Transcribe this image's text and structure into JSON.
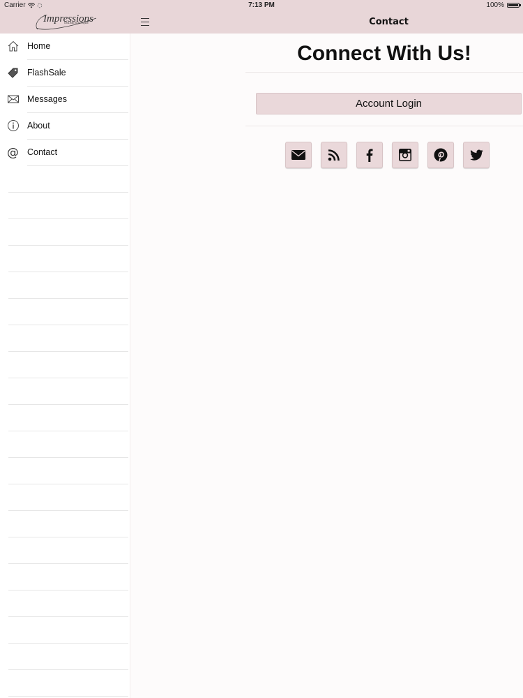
{
  "status_bar": {
    "carrier": "Carrier",
    "time": "7:13 PM",
    "battery": "100%"
  },
  "nav": {
    "logo_text": "Impressions",
    "logo_subtext": "ONLINE BOUTIQUE",
    "title": "Contact"
  },
  "sidebar": {
    "items": [
      {
        "label": "Home",
        "icon": "home-icon"
      },
      {
        "label": "FlashSale",
        "icon": "tag-icon"
      },
      {
        "label": "Messages",
        "icon": "envelope-icon"
      },
      {
        "label": "About",
        "icon": "info-icon"
      },
      {
        "label": "Contact",
        "icon": "at-icon"
      }
    ]
  },
  "main": {
    "heading": "Connect With Us!",
    "login_label": "Account Login",
    "social": [
      "email-icon",
      "rss-icon",
      "facebook-icon",
      "instagram-icon",
      "pinterest-icon",
      "twitter-icon"
    ]
  },
  "colors": {
    "accent": "#e8d6d8",
    "button": "#ead8da"
  }
}
